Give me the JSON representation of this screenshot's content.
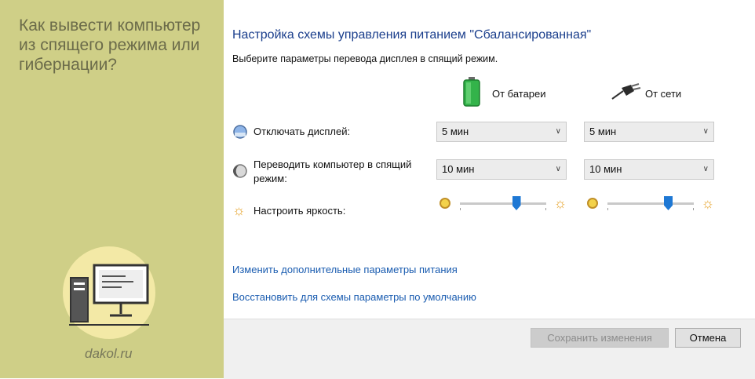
{
  "sidebar": {
    "title": "Как вывести компьютер из спящего режима или гибернации?",
    "brand": "dakol.ru"
  },
  "window": {
    "title": "Настройка схемы управления питанием \"Сбалансированная\"",
    "subtitle": "Выберите параметры перевода дисплея в спящий режим."
  },
  "columns": {
    "battery": "От батареи",
    "ac": "От сети"
  },
  "rows": [
    {
      "label": "Отключать дисплей:",
      "battery": "5 мин",
      "ac": "5 мин"
    },
    {
      "label": "Переводить компьютер в спящий режим:",
      "battery": "10 мин",
      "ac": "10 мин"
    }
  ],
  "brightness": {
    "label": "Настроить яркость:",
    "battery_level": 0.65,
    "ac_level": 0.7
  },
  "links": {
    "advanced": "Изменить дополнительные параметры питания",
    "restore": "Восстановить для схемы параметры по умолчанию"
  },
  "buttons": {
    "save": "Сохранить изменения",
    "cancel": "Отмена"
  },
  "colors": {
    "sidebar_bg": "#cfcf87",
    "title_blue": "#1a3e8c",
    "link_blue": "#1a5cb0",
    "slider_thumb": "#1e78d4"
  },
  "icons": {
    "battery": "battery-icon",
    "ac": "power-plug-icon",
    "display": "display-icon",
    "sleep": "moon-icon",
    "brightness": "sun-icon"
  }
}
